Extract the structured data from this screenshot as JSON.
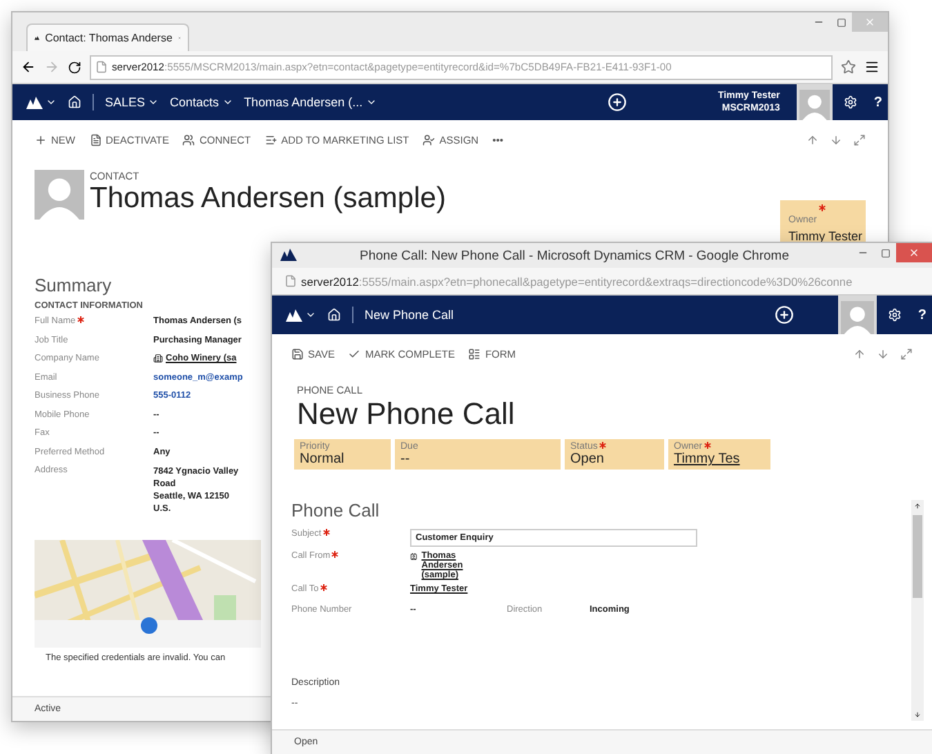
{
  "back_window": {
    "tab_title": "Contact: Thomas Anderse",
    "url_host": "server2012",
    "url_rest": ":5555/MSCRM2013/main.aspx?etn=contact&pagetype=entityrecord&id=%7bC5DB49FA-FB21-E411-93F1-00",
    "nav": [
      "SALES",
      "Contacts",
      "Thomas Andersen (..."
    ],
    "user": {
      "name": "Timmy Tester",
      "org": "MSCRM2013"
    },
    "help": "?",
    "commands": [
      {
        "label": "NEW"
      },
      {
        "label": "DEACTIVATE"
      },
      {
        "label": "CONNECT"
      },
      {
        "label": "ADD TO MARKETING LIST"
      },
      {
        "label": "ASSIGN"
      }
    ],
    "more": "•••",
    "header": {
      "entity": "CONTACT",
      "name": "Thomas Andersen (sample)",
      "owner_label": "Owner",
      "owner_required": true,
      "owner": "Timmy Tester"
    },
    "summary": {
      "title": "Summary",
      "section": "CONTACT INFORMATION",
      "fields": [
        {
          "label": "Full Name",
          "required": true,
          "kind": "text",
          "value": "Thomas Andersen (s"
        },
        {
          "label": "Job Title",
          "required": false,
          "kind": "text",
          "value": "Purchasing Manager"
        },
        {
          "label": "Company Name",
          "required": false,
          "kind": "lookup",
          "value": "Coho Winery (sa"
        },
        {
          "label": "Email",
          "required": false,
          "kind": "link",
          "value": "someone_m@examp"
        },
        {
          "label": "Business Phone",
          "required": false,
          "kind": "link",
          "value": "555-0112"
        },
        {
          "label": "Mobile Phone",
          "required": false,
          "kind": "text",
          "value": "--"
        },
        {
          "label": "Fax",
          "required": false,
          "kind": "text",
          "value": "--"
        },
        {
          "label": "Preferred Method",
          "required": false,
          "kind": "text",
          "value": "Any"
        },
        {
          "label": "Address",
          "required": false,
          "kind": "address",
          "lines": [
            "7842 Ygnacio Valley",
            "Road",
            "Seattle, WA 12150",
            "U.S."
          ]
        }
      ]
    },
    "map": {
      "kind": "picture"
    },
    "map_message": "The specified credentials are invalid. You can",
    "status": "Active"
  },
  "popup": {
    "title": "Phone Call: New Phone Call - Microsoft Dynamics CRM - Google Chrome",
    "url_host": "server2012",
    "url_rest": ":5555/main.aspx?etn=phonecall&pagetype=entityrecord&extraqs=directioncode%3D0%26conne",
    "nav": "New Phone Call",
    "help": "?",
    "commands": [
      {
        "label": "SAVE"
      },
      {
        "label": "MARK COMPLETE"
      },
      {
        "label": "FORM"
      }
    ],
    "header": {
      "entity": "PHONE CALL",
      "name": "New Phone Call",
      "fields": [
        {
          "label": "Priority",
          "required": false,
          "kind": "text",
          "value": "Normal"
        },
        {
          "label": "Due",
          "required": false,
          "kind": "text",
          "value": "--"
        },
        {
          "label": "Status",
          "required": true,
          "kind": "text",
          "value": "Open"
        },
        {
          "label": "Owner",
          "required": true,
          "kind": "link",
          "value": "Timmy Tes"
        }
      ]
    },
    "section": "Phone Call",
    "fields": [
      {
        "label": "Subject",
        "required": true,
        "kind": "input",
        "value": "Customer Enquiry"
      },
      {
        "label": "Call From",
        "required": true,
        "kind": "lookup",
        "value": "Thomas Andersen (sample)"
      },
      {
        "label": "Call To",
        "required": true,
        "kind": "link",
        "value": "Timmy Tester"
      },
      {
        "label": "Phone Number",
        "required": false,
        "kind": "pair",
        "value": "--",
        "pair_label": "Direction",
        "pair_value": "Incoming"
      }
    ],
    "description_label": "Description",
    "description": "--",
    "status": "Open"
  }
}
